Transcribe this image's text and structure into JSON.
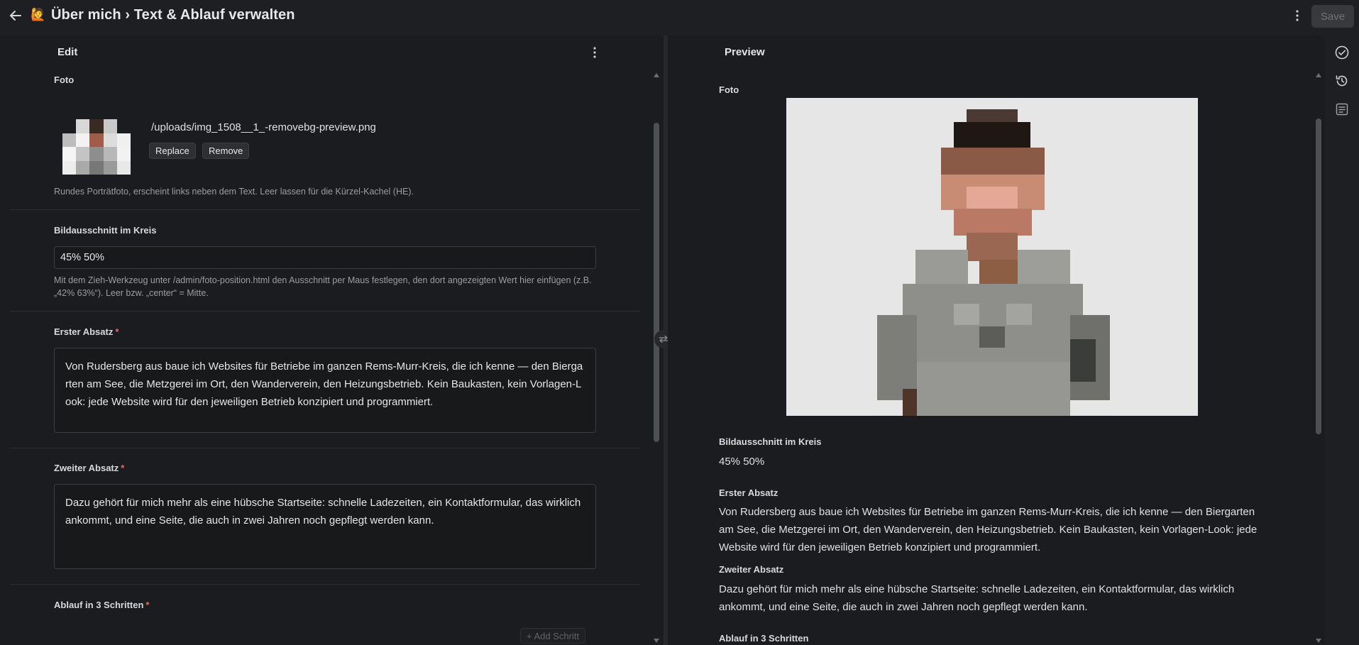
{
  "header": {
    "emoji": "🙋",
    "title": "Über mich › Text & Ablauf verwalten",
    "save_label": "Save"
  },
  "edit": {
    "heading": "Edit",
    "foto": {
      "label": "Foto",
      "path": "/uploads/img_1508__1_-removebg-preview.png",
      "replace_label": "Replace",
      "remove_label": "Remove",
      "help": "Rundes Porträtfoto, erscheint links neben dem Text. Leer lassen für die Kürzel-Kachel (HE)."
    },
    "bildausschnitt": {
      "label": "Bildausschnitt im Kreis",
      "value": "45% 50%",
      "help": "Mit dem Zieh-Werkzeug unter /admin/foto-position.html den Ausschnitt per Maus festlegen, den dort angezeigten Wert hier einfügen (z.B. „42% 63%“). Leer bzw. „center“ = Mitte."
    },
    "erster_absatz": {
      "label": "Erster Absatz",
      "required_mark": "*",
      "value": "Von Rudersberg aus baue ich Websites für Betriebe im ganzen Rems-Murr-Kreis, die ich kenne — den Biergarten am See, die Metzgerei im Ort, den Wanderverein, den Heizungsbetrieb. Kein Baukasten, kein Vorlagen-Look: jede Website wird für den jeweiligen Betrieb konzipiert und programmiert."
    },
    "zweiter_absatz": {
      "label": "Zweiter Absatz",
      "required_mark": "*",
      "value": "Dazu gehört für mich mehr als eine hübsche Startseite: schnelle Ladezeiten, ein Kontaktformular, das wirklich ankommt, und eine Seite, die auch in zwei Jahren noch gepflegt werden kann."
    },
    "ablauf": {
      "label": "Ablauf in 3 Schritten",
      "required_mark": "*",
      "add_label": "Add Schritt"
    }
  },
  "preview": {
    "heading": "Preview",
    "foto_label": "Foto",
    "bildausschnitt_label": "Bildausschnitt im Kreis",
    "bildausschnitt_value": "45% 50%",
    "erster_label": "Erster Absatz",
    "erster_value": "Von Rudersberg aus baue ich Websites für Betriebe im ganzen Rems-Murr-Kreis, die ich kenne — den Biergarten am See, die Metzgerei im Ort, den Wanderverein, den Heizungsbetrieb. Kein Baukasten, kein Vorlagen-Look: jede Website wird für den jeweiligen Betrieb konzipiert und programmiert.",
    "zweiter_label": "Zweiter Absatz",
    "zweiter_value": "Dazu gehört für mich mehr als eine hübsche Startseite: schnelle Ladezeiten, ein Kontaktformular, das wirklich ankommt, und eine Seite, die auch in zwei Jahren noch gepflegt werden kann.",
    "ablauf_label": "Ablauf in 3 Schritten"
  },
  "colors": {
    "background": "#1e1f22",
    "pane": "#1b1c1f",
    "required": "#e06c6c",
    "photo_bg": "#e6e6e6"
  },
  "icons": {
    "back": "arrow-left-icon",
    "menu": "kebab-menu-icon",
    "rail": [
      "check-circle-icon",
      "history-icon",
      "form-list-icon"
    ],
    "splitter": "swap-arrows-icon"
  }
}
